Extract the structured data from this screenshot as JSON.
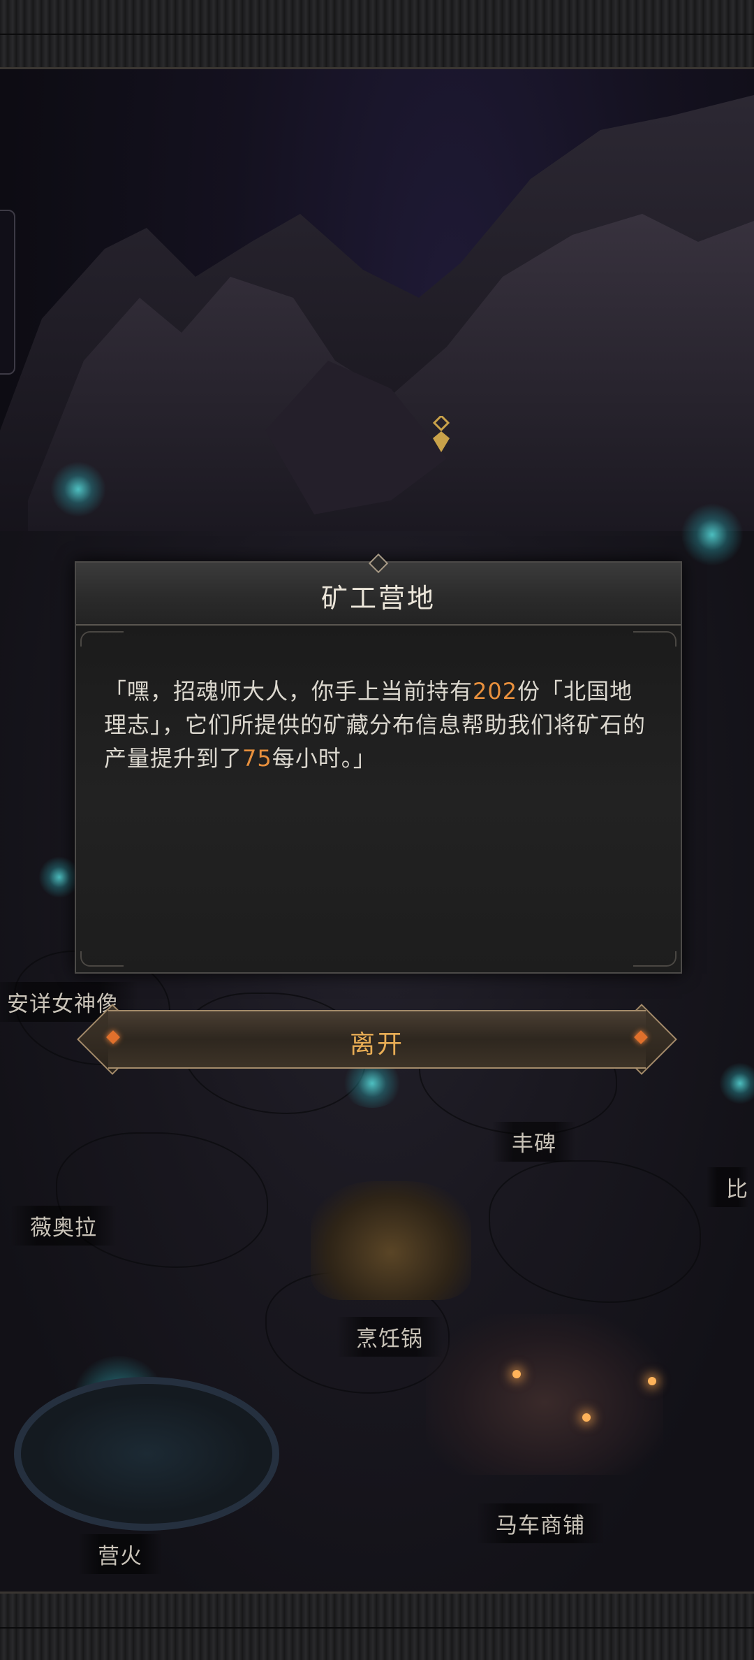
{
  "dialog": {
    "title": "矿工营地",
    "text_part1": "「嘿，招魂师大人，你手上当前持有",
    "held_count": "202",
    "text_part2": "份「北国地理志」，它们所提供的矿藏分布信息帮助我们将矿石的产量提升到了",
    "rate_value": "75",
    "text_part3": "每小时。」",
    "highlight_color": "#e8903d"
  },
  "leave_button": {
    "label": "离开"
  },
  "map_labels": {
    "goddess_statue": "安详女神像",
    "fengbei": "丰碑",
    "bi_partial": "比",
    "viola": "薇奥拉",
    "cooking_pot": "烹饪锅",
    "wagon_shop": "马车商铺",
    "campfire": "营火"
  },
  "icons": {
    "quest_marker": "map-quest-marker-icon",
    "crystal": "glowing-crystal-icon"
  }
}
